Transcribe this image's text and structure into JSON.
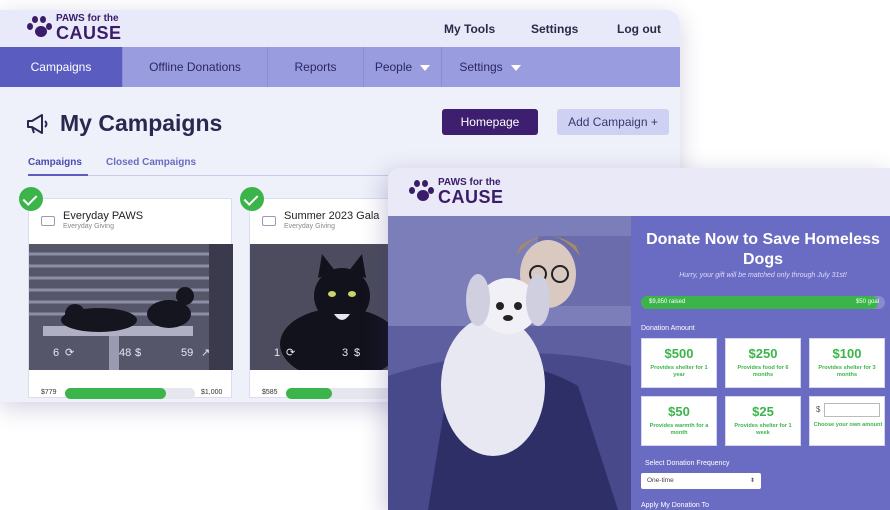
{
  "dashboard": {
    "logo": {
      "line1": "PAWS for the",
      "line2": "CAUSE"
    },
    "top_links": [
      "My Tools",
      "Settings",
      "Log out"
    ],
    "nav_tabs": [
      "Campaigns",
      "Offline Donations",
      "Reports",
      "People",
      "Settings"
    ],
    "page_title": "My Campaigns",
    "homepage_button": "Homepage",
    "add_campaign_button": "Add Campaign +",
    "sub_tabs": [
      "Campaigns",
      "Closed Campaigns"
    ],
    "campaigns": [
      {
        "name": "Everyday PAWS",
        "type": "Everyday Giving",
        "stats": [
          "6",
          "48",
          "59"
        ],
        "raised": "$779",
        "goal": "$1,000",
        "progress": 0.78
      },
      {
        "name": "Summer 2023 Gala",
        "type": "Everyday Giving",
        "stats": [
          "1",
          "3"
        ],
        "raised": "$585",
        "goal": "",
        "progress": 0.35
      }
    ],
    "colors": {
      "brand": "#3a1c69",
      "nav": "#9a9ce0",
      "nav_active": "#5a5cc0",
      "success": "#3bb54a"
    }
  },
  "donation": {
    "logo": {
      "line1": "PAWS for the",
      "line2": "CAUSE"
    },
    "title": "Donate Now to Save Homeless Dogs",
    "subtitle": "Hurry, your gift will be matched only through July 31st!",
    "raised": "$9,850 raised",
    "goal": "$50 goal",
    "progress": 0.97,
    "amount_label": "Donation Amount",
    "tiles": [
      {
        "amount": "$500",
        "desc": "Provides shelter for 1 year"
      },
      {
        "amount": "$250",
        "desc": "Provides food for 6 months"
      },
      {
        "amount": "$100",
        "desc": "Provides shelter for 3 months"
      },
      {
        "amount": "$50",
        "desc": "Provides warmth for a month"
      },
      {
        "amount": "$25",
        "desc": "Provides shelter for 1 week"
      }
    ],
    "custom": {
      "symbol": "$",
      "desc": "Choose your own amount"
    },
    "frequency_label": "Select Donation Frequency",
    "frequency_value": "One-time",
    "apply_label": "Apply My Donation To"
  }
}
